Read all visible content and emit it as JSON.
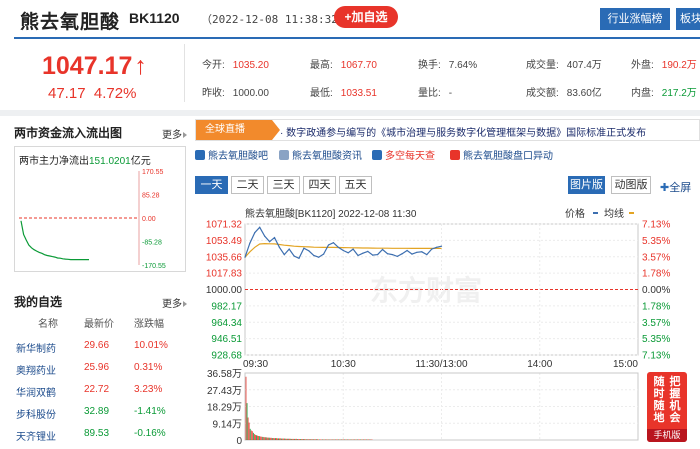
{
  "header": {
    "stock_name": "熊去氧胆酸",
    "stock_code": "BK1120",
    "timestamp": "（2022-12-08 11:38:32）",
    "add_favorite": "+加自选",
    "btn_industry_rank": "行业涨幅榜",
    "btn_board": "板块"
  },
  "quote": {
    "price": "1047.17",
    "price_arrow": "↑",
    "change": "47.17",
    "change_pct": "4.72%",
    "fields": [
      {
        "label": "今开:",
        "value": "1035.20",
        "tone": "up"
      },
      {
        "label": "最高:",
        "value": "1067.70",
        "tone": "up"
      },
      {
        "label": "换手:",
        "value": "7.64%",
        "tone": "neutral"
      },
      {
        "label": "成交量:",
        "value": "407.4万",
        "tone": "neutral"
      },
      {
        "label": "外盘:",
        "value": "190.2万",
        "tone": "up"
      },
      {
        "label": "昨收:",
        "value": "1000.00",
        "tone": "neutral"
      },
      {
        "label": "最低:",
        "value": "1033.51",
        "tone": "up"
      },
      {
        "label": "量比:",
        "value": "-",
        "tone": "neutral"
      },
      {
        "label": "成交额:",
        "value": "83.60亿",
        "tone": "neutral"
      },
      {
        "label": "内盘:",
        "value": "217.2万",
        "tone": "down"
      }
    ]
  },
  "capital_flow": {
    "title": "两市资金流入流出图",
    "more": "更多",
    "label_prefix": "两市主力净流出",
    "label_value": "151.0201",
    "label_unit": "亿元",
    "y_ticks": [
      "170.55",
      "85.28",
      "0.00",
      "-85.28",
      "-170.55"
    ]
  },
  "favorites": {
    "title": "我的自选",
    "more": "更多",
    "columns": [
      "名称",
      "最新价",
      "涨跌幅"
    ],
    "rows": [
      {
        "name": "新华制药",
        "price": "29.66",
        "pct": "10.01%",
        "dir": "up"
      },
      {
        "name": "奥翔药业",
        "price": "25.96",
        "pct": "0.31%",
        "dir": "up"
      },
      {
        "name": "华润双鹤",
        "price": "22.72",
        "pct": "3.23%",
        "dir": "up"
      },
      {
        "name": "步科股份",
        "price": "32.89",
        "pct": "-1.41%",
        "dir": "down"
      },
      {
        "name": "天齐锂业",
        "price": "89.53",
        "pct": "-0.16%",
        "dir": "down"
      }
    ]
  },
  "news": {
    "tag": "全球直播",
    "text": "· 数字政通参与编写的《城市治理与服务数字化管理框架与数据》国际标准正式发布"
  },
  "links": [
    {
      "label": "熊去氧胆酸吧",
      "icon": "forum-icon",
      "color": "#2a6bb5"
    },
    {
      "label": "熊去氧胆酸资讯",
      "icon": "news-icon",
      "color": "#8aa3c4"
    },
    {
      "label": "多空每天查",
      "icon": "monitor-icon",
      "color": "#2a6bb5"
    },
    {
      "label": "熊去氧胆酸盘口异动",
      "icon": "bar-chart-icon",
      "color": "#e8342a"
    }
  ],
  "tabs": [
    "一天",
    "二天",
    "三天",
    "四天",
    "五天"
  ],
  "view_buttons": [
    "图片版",
    "动图版"
  ],
  "fullscreen": "全屏",
  "ad": {
    "col1": "随时随地",
    "col2": "把握机会",
    "foot": "手机版"
  },
  "chart_data": {
    "type": "line",
    "title": "熊去氧胆酸[BK1120]  2022-12-08  11:30",
    "legend": [
      {
        "name": "价格",
        "color": "#3d6fb0"
      },
      {
        "name": "均线",
        "color": "#e3a423"
      }
    ],
    "prev_close": 1000.0,
    "ylim": [
      928.68,
      1071.32
    ],
    "y_ticks": [
      "1071.32",
      "1053.49",
      "1035.66",
      "1017.83",
      "1000.00",
      "982.17",
      "964.34",
      "946.51",
      "928.68"
    ],
    "pct_ticks": [
      "7.13%",
      "5.35%",
      "3.57%",
      "1.78%",
      "0.00%",
      "1.78%",
      "3.57%",
      "5.35%",
      "7.13%"
    ],
    "x_ticks": [
      "09:30",
      "10:30",
      "11:30/13:00",
      "14:00",
      "15:00"
    ],
    "price_times": [
      0,
      3,
      6,
      9,
      12,
      15,
      18,
      21,
      24,
      27,
      30,
      33,
      36,
      39,
      42,
      45,
      48,
      51,
      54,
      57,
      60,
      63,
      66,
      69,
      72,
      75,
      78,
      81,
      84,
      87,
      90,
      93,
      96,
      99,
      102,
      105,
      108,
      111,
      114,
      117,
      120
    ],
    "price": [
      1035.2,
      1050.5,
      1062.0,
      1067.7,
      1058.0,
      1052.0,
      1056.5,
      1046.0,
      1038.0,
      1044.0,
      1036.5,
      1034.0,
      1045.0,
      1042.0,
      1037.0,
      1035.2,
      1038.5,
      1048.5,
      1051.0,
      1046.0,
      1042.5,
      1040.0,
      1044.0,
      1037.0,
      1039.5,
      1041.5,
      1037.5,
      1038.0,
      1043.5,
      1039.0,
      1038.0,
      1036.0,
      1039.0,
      1042.5,
      1038.5,
      1040.5,
      1041.0,
      1038.0,
      1044.0,
      1046.0,
      1047.17
    ],
    "avg": [
      1035.2,
      1041.0,
      1046.0,
      1049.5,
      1050.0,
      1049.8,
      1049.6,
      1049.0,
      1048.2,
      1047.8,
      1047.2,
      1046.8,
      1046.6,
      1046.4,
      1046.1,
      1045.9,
      1045.8,
      1045.8,
      1045.8,
      1045.7,
      1045.6,
      1045.5,
      1045.4,
      1045.3,
      1045.2,
      1045.2,
      1045.1,
      1045.0,
      1045.0,
      1045.0,
      1044.9,
      1044.9,
      1044.9,
      1044.9,
      1044.8,
      1044.8,
      1044.8,
      1044.8,
      1044.8,
      1044.8,
      1044.8
    ],
    "volume_ticks": [
      "36.58万",
      "27.43万",
      "18.29万",
      "9.14万",
      "0"
    ],
    "volume_max": 36.58,
    "volume": [
      34.5,
      20.1,
      12.3,
      9.5,
      6.1,
      5.2,
      4.8,
      3.9,
      3.2,
      2.8,
      2.6,
      2.4,
      2.2,
      2.1,
      1.9,
      1.8,
      1.7,
      1.6,
      1.5,
      1.5,
      1.4,
      1.3,
      1.3,
      1.2,
      1.2,
      1.1,
      1.1,
      1.0,
      1.0,
      1.0,
      0.9,
      0.9,
      0.9,
      0.9,
      0.8,
      0.8,
      0.8,
      0.8,
      0.7,
      0.7,
      0.7,
      0.7,
      0.7,
      0.6,
      0.6,
      0.6,
      0.6,
      0.6,
      0.6,
      0.5,
      0.5,
      0.5,
      0.5,
      0.5,
      0.5,
      0.5,
      0.5,
      0.4,
      0.4,
      0.4,
      0.4,
      0.4,
      0.4,
      0.4,
      0.4,
      0.4,
      0.4,
      0.4,
      0.4,
      0.3,
      0.3,
      0.3,
      0.3,
      0.3,
      0.3,
      0.3,
      0.3,
      0.3,
      0.3,
      0.3,
      0.3,
      0.3,
      0.3,
      0.3,
      0.3,
      0.3,
      0.3,
      0.3,
      0.3,
      0.3,
      0.3,
      0.3,
      0.3,
      0.3,
      0.3,
      0.3,
      0.3,
      0.3,
      0.3,
      0.3,
      0.3,
      0.3,
      0.3,
      0.3,
      0.3,
      0.3,
      0.3,
      0.3,
      0.3,
      0.3,
      0.3,
      0.3,
      0.3,
      0.3,
      0.3,
      0.3,
      0.3,
      0.3,
      0.3,
      0.3,
      0.3
    ],
    "watermark": "东方财富"
  },
  "capital_flow_data": {
    "type": "line",
    "ylim": [
      -170.55,
      170.55
    ],
    "values": [
      -10,
      -60,
      -80,
      -98,
      -108,
      -115,
      -120,
      -125,
      -128,
      -133,
      -136,
      -138,
      -140,
      -142,
      -145,
      -146,
      -148,
      -149,
      -150,
      -151,
      -151,
      -151,
      -151,
      -151,
      -151,
      -151,
      -151
    ]
  }
}
